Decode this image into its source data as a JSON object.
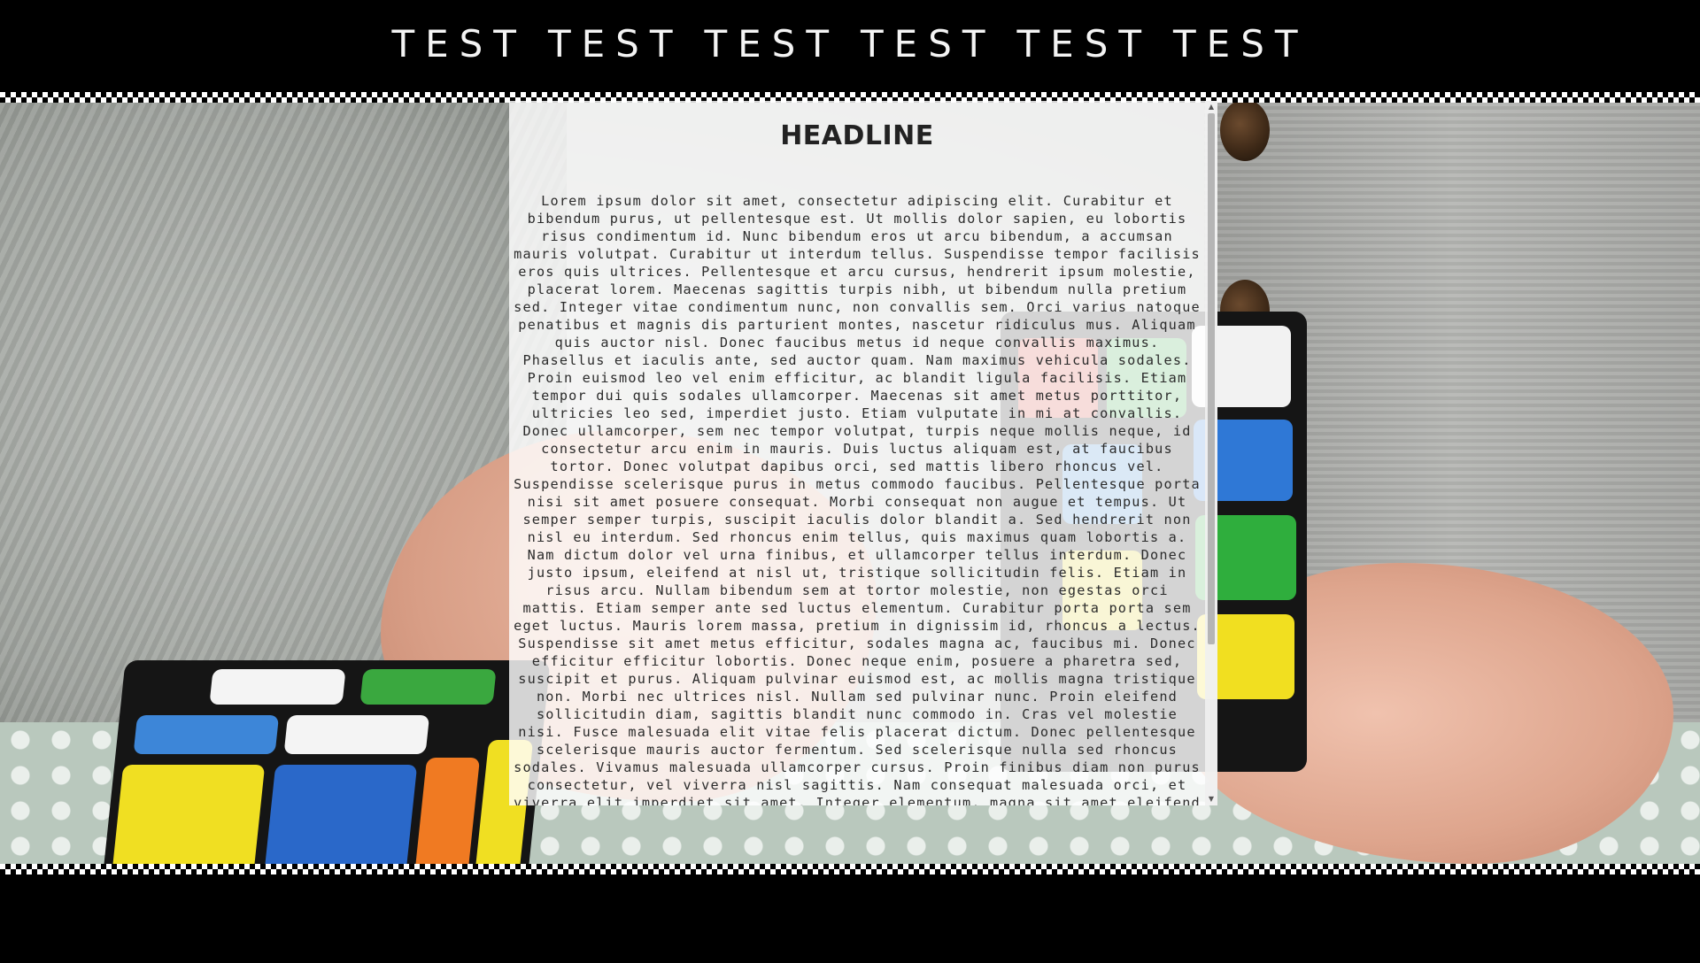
{
  "nav": {
    "items": [
      {
        "label": "TEST"
      },
      {
        "label": "TEST"
      },
      {
        "label": "TEST"
      },
      {
        "label": "TEST"
      },
      {
        "label": "TEST"
      },
      {
        "label": "TEST"
      }
    ]
  },
  "panel": {
    "headline": "HEADLINE",
    "body": "Lorem ipsum dolor sit amet, consectetur adipiscing elit. Curabitur et bibendum purus, ut pellentesque est. Ut mollis dolor sapien, eu lobortis risus condimentum id. Nunc bibendum eros ut arcu bibendum, a accumsan mauris volutpat. Curabitur ut interdum tellus. Suspendisse tempor facilisis eros quis ultrices. Pellentesque et arcu cursus, hendrerit ipsum molestie, placerat lorem. Maecenas sagittis turpis nibh, ut bibendum nulla pretium sed. Integer vitae condimentum nunc, non convallis sem. Orci varius natoque penatibus et magnis dis parturient montes, nascetur ridiculus mus. Aliquam quis auctor nisl. Donec faucibus metus id neque convallis maximus. Phasellus et iaculis ante, sed auctor quam. Nam maximus vehicula sodales. Proin euismod leo vel enim efficitur, ac blandit ligula facilisis. Etiam tempor dui quis sodales ullamcorper. Maecenas sit amet metus porttitor, ultricies leo sed, imperdiet justo. Etiam vulputate in mi at convallis. Donec ullamcorper, sem nec tempor volutpat, turpis neque mollis neque, id consectetur arcu enim in mauris. Duis luctus aliquam est, at faucibus tortor. Donec volutpat dapibus orci, sed mattis libero rhoncus vel. Suspendisse scelerisque purus in metus commodo faucibus. Pellentesque porta nisi sit amet posuere consequat. Morbi consequat non augue et tempus. Ut semper semper turpis, suscipit iaculis dolor blandit a. Sed hendrerit non nisl eu interdum. Sed rhoncus enim tellus, quis maximus quam lobortis a. Nam dictum dolor vel urna finibus, et ullamcorper tellus interdum. Donec justo ipsum, eleifend at nisl ut, tristique sollicitudin felis. Etiam in risus arcu. Nullam bibendum sem at tortor molestie, non egestas orci mattis. Etiam semper ante sed luctus elementum. Curabitur porta porta sem eget luctus. Mauris lorem massa, pretium in dignissim id, rhoncus a lectus. Suspendisse sit amet metus efficitur, sodales magna ac, faucibus mi. Donec efficitur efficitur lobortis. Donec neque enim, posuere a pharetra sed, suscipit et purus. Aliquam pulvinar euismod est, ac mollis magna tristique non. Morbi nec ultrices nisl. Nullam sed pulvinar nunc. Proin eleifend sollicitudin diam, sagittis blandit nunc commodo in. Cras vel molestie nisi. Fusce malesuada elit vitae felis placerat dictum. Donec pellentesque scelerisque mauris auctor fermentum. Sed scelerisque nulla sed rhoncus sodales. Vivamus malesuada ullamcorper cursus. Proin finibus diam non purus consectetur, vel viverra nisl sagittis. Nam consequat malesuada orci, et viverra elit imperdiet sit amet. Integer elementum, magna sit amet eleifend egestas, lectus arcu imperdiet eros, facilisis elementum enim magna ac diam. Vestibulum sagittis malesuada urna, fringilla tempor lectus ullamcorper at."
  },
  "icons": {
    "scroll_up": "scroll-up-arrow-icon",
    "scroll_down": "scroll-down-arrow-icon"
  },
  "colors": {
    "nav_background": "#000000",
    "nav_text": "#f4f4f4",
    "panel_background": "rgba(255,255,255,0.82)"
  }
}
